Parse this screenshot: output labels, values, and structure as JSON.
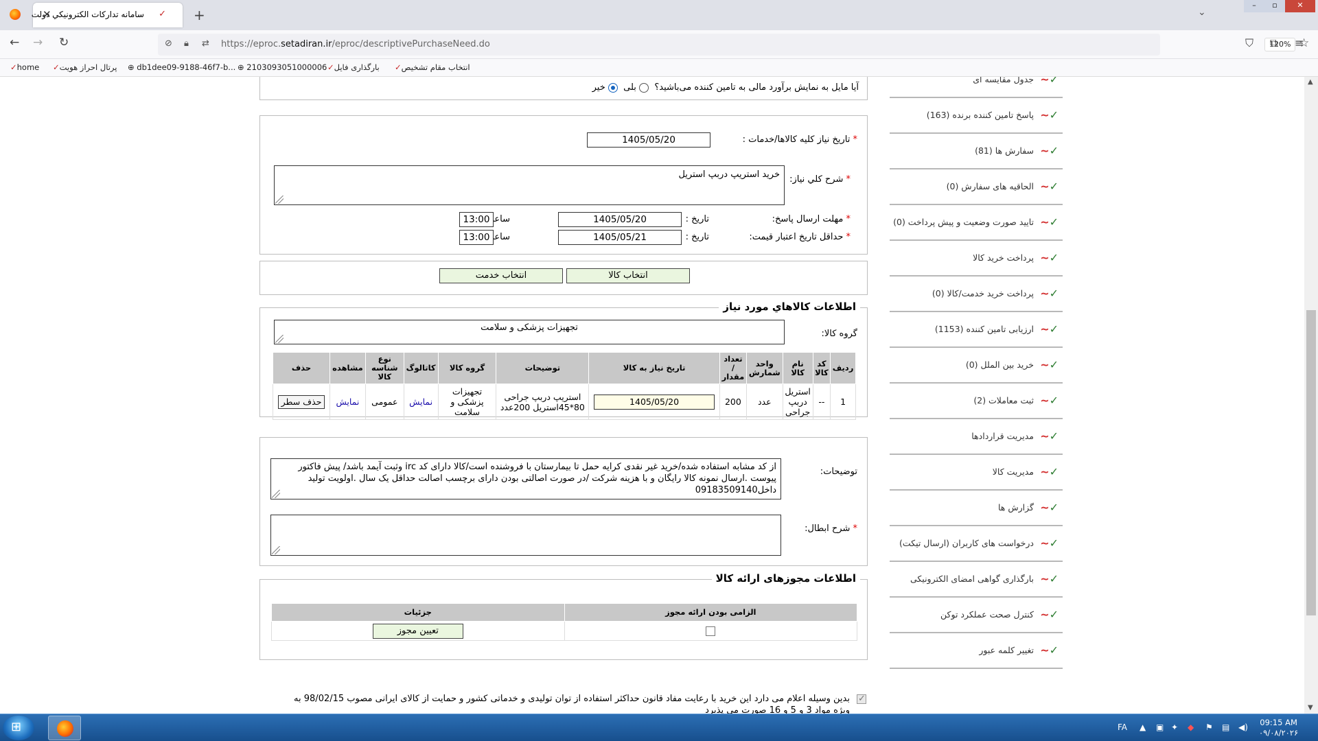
{
  "browser": {
    "tab_title": "سامانه تداركات الكترونيكي دولت",
    "url_prefix": "https://eproc.",
    "url_domain": "setadiran.ir",
    "url_path": "/eproc/descriptivePurchaseNeed.do",
    "zoom": "120%"
  },
  "bookmarks": [
    {
      "label": "home"
    },
    {
      "label": "پرتال احراز هویت"
    },
    {
      "label": "db1dee09-9188-46f7-b..."
    },
    {
      "label": "2103093051000006"
    },
    {
      "label": "بارگذاری فایل"
    },
    {
      "label": "انتخاب مقام تشخيص"
    }
  ],
  "sidebar": {
    "items": [
      {
        "label": "جدول مقايسه ای"
      },
      {
        "label": "پاسخ تامين کننده برنده (163)"
      },
      {
        "label": "سفارش ها (81)"
      },
      {
        "label": "الحاقيه های سفارش (0)"
      },
      {
        "label": "تاييد صورت وضعيت و پيش پرداخت (0)"
      },
      {
        "label": "پرداخت خريد کالا"
      },
      {
        "label": "پرداخت خريد خدمت/کالا (0)"
      },
      {
        "label": "ارزيابی تامين کننده (1153)"
      },
      {
        "label": "خريد بين الملل  (0)"
      },
      {
        "label": "ثبت معاملات  (2)"
      },
      {
        "label": "مديريت قراردادها"
      },
      {
        "label": "مديريت کالا"
      },
      {
        "label": "گزارش ها"
      },
      {
        "label": "درخواست های کاربران (ارسال تیکت)"
      },
      {
        "label": "بارگذاری گواهی امضای الکترونیکی"
      },
      {
        "label": "کنترل صحت عملکرد توکن"
      },
      {
        "label": "تغيير کلمه عبور"
      }
    ]
  },
  "estimate": {
    "question": "آیا مایل به نمایش برآورد مالی به تامین کننده می‌باشید؟",
    "yes": "بلی",
    "no": "خیر",
    "selected": "خیر"
  },
  "need": {
    "need_date_label": "تاريخ نياز كليه كالاها/خدمات :",
    "need_date": "1405/05/20",
    "general_desc_label": "شرح كلي نياز:",
    "general_desc": "خرید استریپ دربپ استریل",
    "reply_deadline_label": "مهلت ارسال پاسخ:",
    "reply_date_label": "تاريخ :",
    "reply_date": "1405/05/20",
    "reply_time_label": "ساعت :",
    "reply_time": "13:00",
    "validity_label": "حداقل تاريخ اعتبار قيمت:",
    "validity_date_label": "تاريخ :",
    "validity_date": "1405/05/21",
    "validity_time_label": "ساعت :",
    "validity_time": "13:00"
  },
  "buttons": {
    "select_goods": "انتخاب كالا",
    "select_service": "انتخاب خدمت"
  },
  "goods": {
    "legend": "اطلاعات كالاهاي مورد نياز",
    "group_label": "گروه كالا:",
    "group_value": "تجهیزات پزشکی و سلامت",
    "columns": [
      "رديف",
      "كد كالا",
      "نام كالا",
      "واحد شمارش",
      "تعداد / مقدار",
      "تاريخ نياز به كالا",
      "توضيحات",
      "گروه كالا",
      "كاتالوگ",
      "نوع شناسه كالا",
      "مشاهده",
      "حذف"
    ],
    "rows": [
      {
        "row": "1",
        "code": "--",
        "name": "استریل دربپ جراحی",
        "unit": "عدد",
        "qty": "200",
        "date": "1405/05/20",
        "desc": "استریپ دربپ جراحی 80*45استریل 200عدد",
        "group": "تجهیزات پزشکی و سلامت",
        "catalog": "نمايش",
        "id_type": "عمومی",
        "view": "نمايش",
        "delete": "حذف سطر"
      }
    ]
  },
  "notes": {
    "desc_label": "توضيحات:",
    "desc_text": "از کد مشابه استفاده شده/خرید غیر نقدی کرایه حمل تا بیمارستان با فروشنده است/کالا دارای کد irc  وثبت آیمد باشد/ پیش فاکتور پیوست .ارسال نمونه کالا رایگان و با هزینه شرکت /در صورت اصالتی بودن دارای برچسب اصالت حداقل یک سال .اولویت تولید داخل09183509140",
    "cancel_label": "شرح ابطال:",
    "cancel_text": ""
  },
  "permits": {
    "legend": "اطلاعات مجوزهای ارائه كالا",
    "col_required": "الزامی بودن ارائه مجوز",
    "col_details": "جزئيات",
    "required_checked": false,
    "assign_button": "تعيين مجوز"
  },
  "declaration": {
    "checked": true,
    "text": "بدین وسیله اعلام می دارد این خرید با رعایت مفاد قانون حداکثر استفاده از توان تولیدی و خدماتی کشور و حمایت از کالای ایرانی مصوب 98/02/15 به",
    "text2": "ویژه مواد 3 و 5 و 16 صورت می پذیرد"
  },
  "taskbar": {
    "lang": "FA",
    "time": "09:15 AM",
    "date": "۰۹/۰۸/۲۰۲۶"
  }
}
